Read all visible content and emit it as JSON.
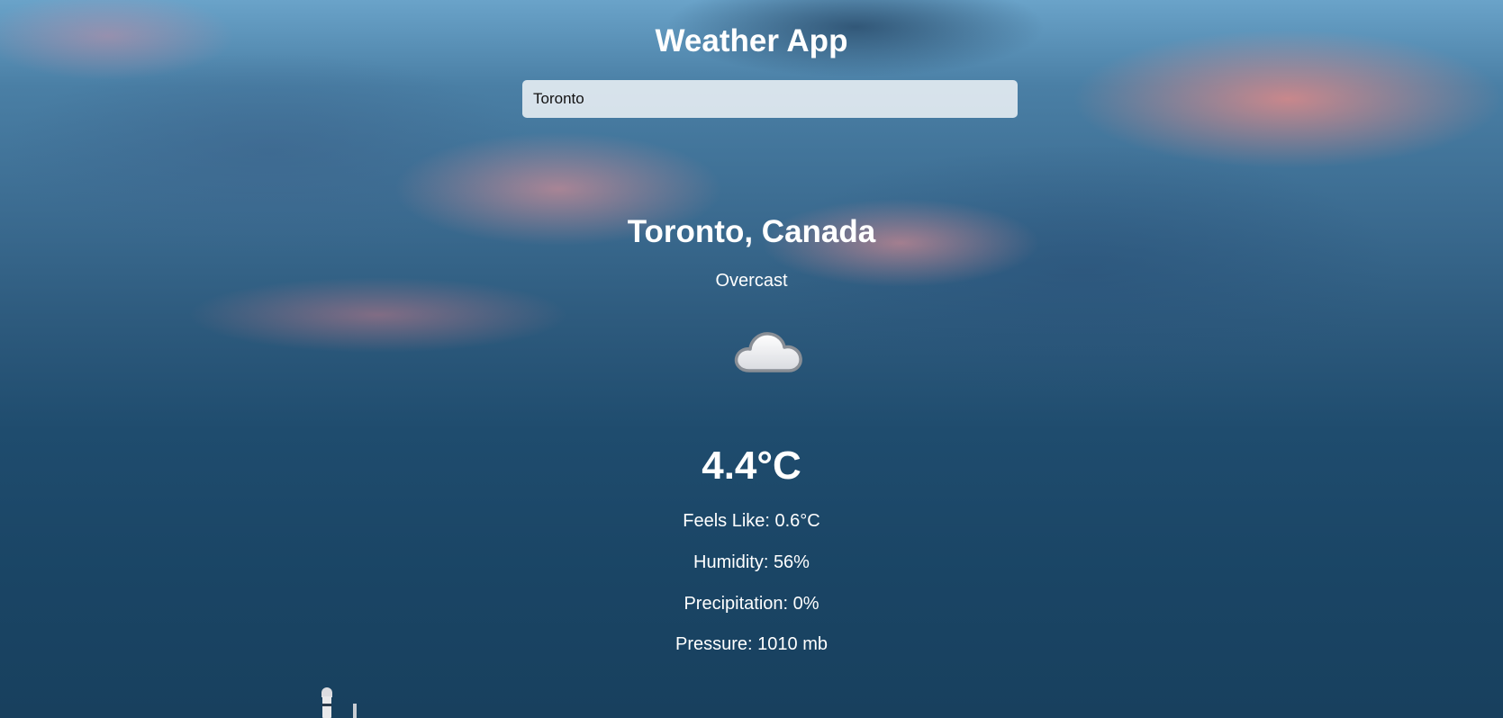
{
  "app": {
    "title": "Weather App"
  },
  "search": {
    "value": "Toronto"
  },
  "current": {
    "location": "Toronto, Canada",
    "condition": "Overcast",
    "icon": "cloud-icon",
    "temperature": "4.4°C",
    "feels_like": "Feels Like: 0.6°C",
    "humidity": "Humidity: 56%",
    "precipitation": "Precipitation: 0%",
    "pressure": "Pressure: 1010 mb"
  },
  "colors": {
    "text": "#ffffff",
    "sky_dark": "#1f4c6e",
    "cloud_pink": "#ff9690"
  }
}
